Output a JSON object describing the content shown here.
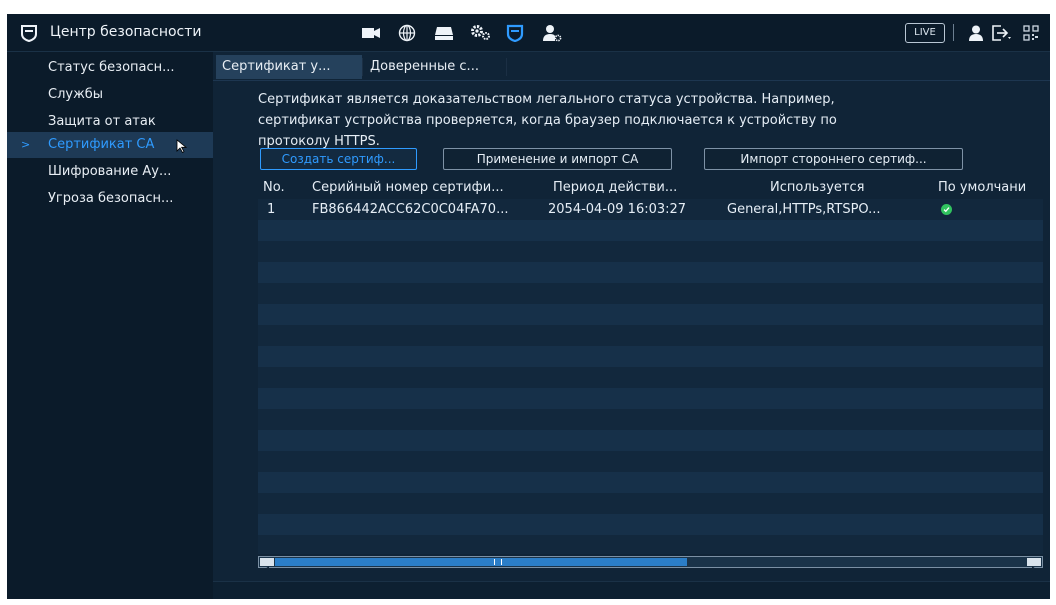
{
  "app": {
    "title": "Центр безопасности",
    "live_label": "LIVE",
    "colors": {
      "accent": "#2f9bff",
      "background": "#0f2233",
      "status_ok": "#31c35f"
    },
    "toolbar_icons": [
      "camera-icon",
      "globe-icon",
      "storage-icon",
      "settings-icon",
      "security-shield-icon",
      "account-settings-icon"
    ],
    "right_icons": [
      "user-icon",
      "logout-icon",
      "qr-code-icon"
    ]
  },
  "sidebar": {
    "items": [
      {
        "label": "Статус безопасн..."
      },
      {
        "label": "Службы"
      },
      {
        "label": "Защита от атак"
      },
      {
        "label": "Сертификат CA"
      },
      {
        "label": "Шифрование Ау..."
      },
      {
        "label": "Угроза безопасн..."
      }
    ],
    "active_index": 3
  },
  "tabs": [
    {
      "label": "Сертификат у..."
    },
    {
      "label": "Доверенные с..."
    }
  ],
  "description": {
    "line1": "Сертификат является доказательством легального статуса устройства. Например,",
    "line2": "сертификат устройства проверяется, когда браузер подключается к устройству по",
    "line3": "протоколу HTTPS."
  },
  "buttons": {
    "create": "Создать сертиф...",
    "apply_import": "Применение и импорт CA",
    "import_third_party": "Импорт стороннего сертиф..."
  },
  "table": {
    "headers": [
      "No.",
      "Серийный номер сертифи...",
      "Период действи...",
      "Используется",
      "По умолчани"
    ],
    "rows": [
      {
        "no": "1",
        "serial": "FB866442ACC62C0C04FA70...",
        "period": "2054-04-09 16:03:27",
        "used": "General,HTTPs,RTSPO...",
        "default_icon": "check-circle-icon"
      }
    ]
  }
}
